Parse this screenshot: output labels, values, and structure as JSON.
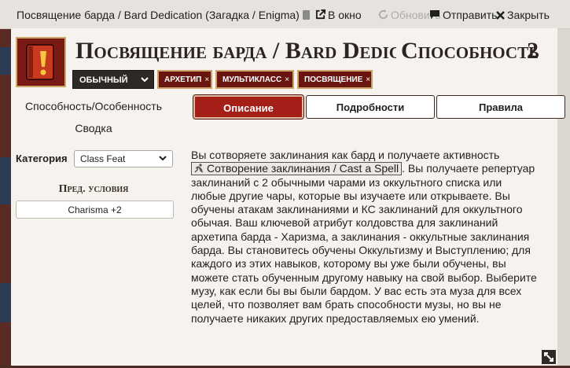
{
  "window": {
    "title": "Посвящение барда / Bard Dedication (Загадка / Enigma)",
    "open_label": "В окно",
    "refresh_label": "Обновить",
    "send_label": "Отправить",
    "close_label": "Закрыть"
  },
  "header": {
    "name": "Посвящение барда / Bard Dedication",
    "type_label": "Способность",
    "level": "2",
    "rarity": "ОБЫЧНЫЙ",
    "traits": [
      "АРХЕТИП",
      "МУЛЬТИКЛАСС",
      "ПОСВЯЩЕНИЕ"
    ],
    "remove_glyph": "×"
  },
  "sidebar": {
    "link_label": "Способность/Особенность",
    "summary_label": "Сводка",
    "category_label": "Категория",
    "category_value": "Class Feat",
    "prereq_heading": "Пред. условия",
    "prereq_value": "Charisma +2"
  },
  "tabs": [
    "Описание",
    "Подробности",
    "Правила"
  ],
  "description": {
    "part1": "Вы сотворяете заклинания как бард и получаете активность",
    "action": "Сотворение заклинания / Cast a Spell",
    "part2": ". Вы получаете репертуар заклинаний с 2 обычными чарами из оккультного списка или любые другие чары, которые вы изучаете или открываете. Вы обучены атакам заклинаниями и КС заклинаний для оккультного обычая. Ваш ключевой атрибут колдовства для заклинаний архетипа барда - Харизма, а заклинания - оккультные заклинания барда. Вы становитесь обучены Оккультизму и Выступлению; для каждого из этих навыков, которому вы уже были обучены, вы можете стать обученным другому навыку на свой выбор. Выберите музу, как если бы вы были бардом. У вас есть эта муза для всех целей, что позволяет вам брать способности музы, но вы не получаете никаких других предоставляемых ею умений."
  },
  "colors": {
    "accent": "#a31f17",
    "trait_bg": "#6b1511",
    "trait_border": "#c9a169"
  },
  "icons": [
    "book-icon",
    "external-link-icon",
    "refresh-icon",
    "chat-icon",
    "close-icon",
    "feat-portrait-icon",
    "running-action-icon",
    "resize-icon"
  ]
}
